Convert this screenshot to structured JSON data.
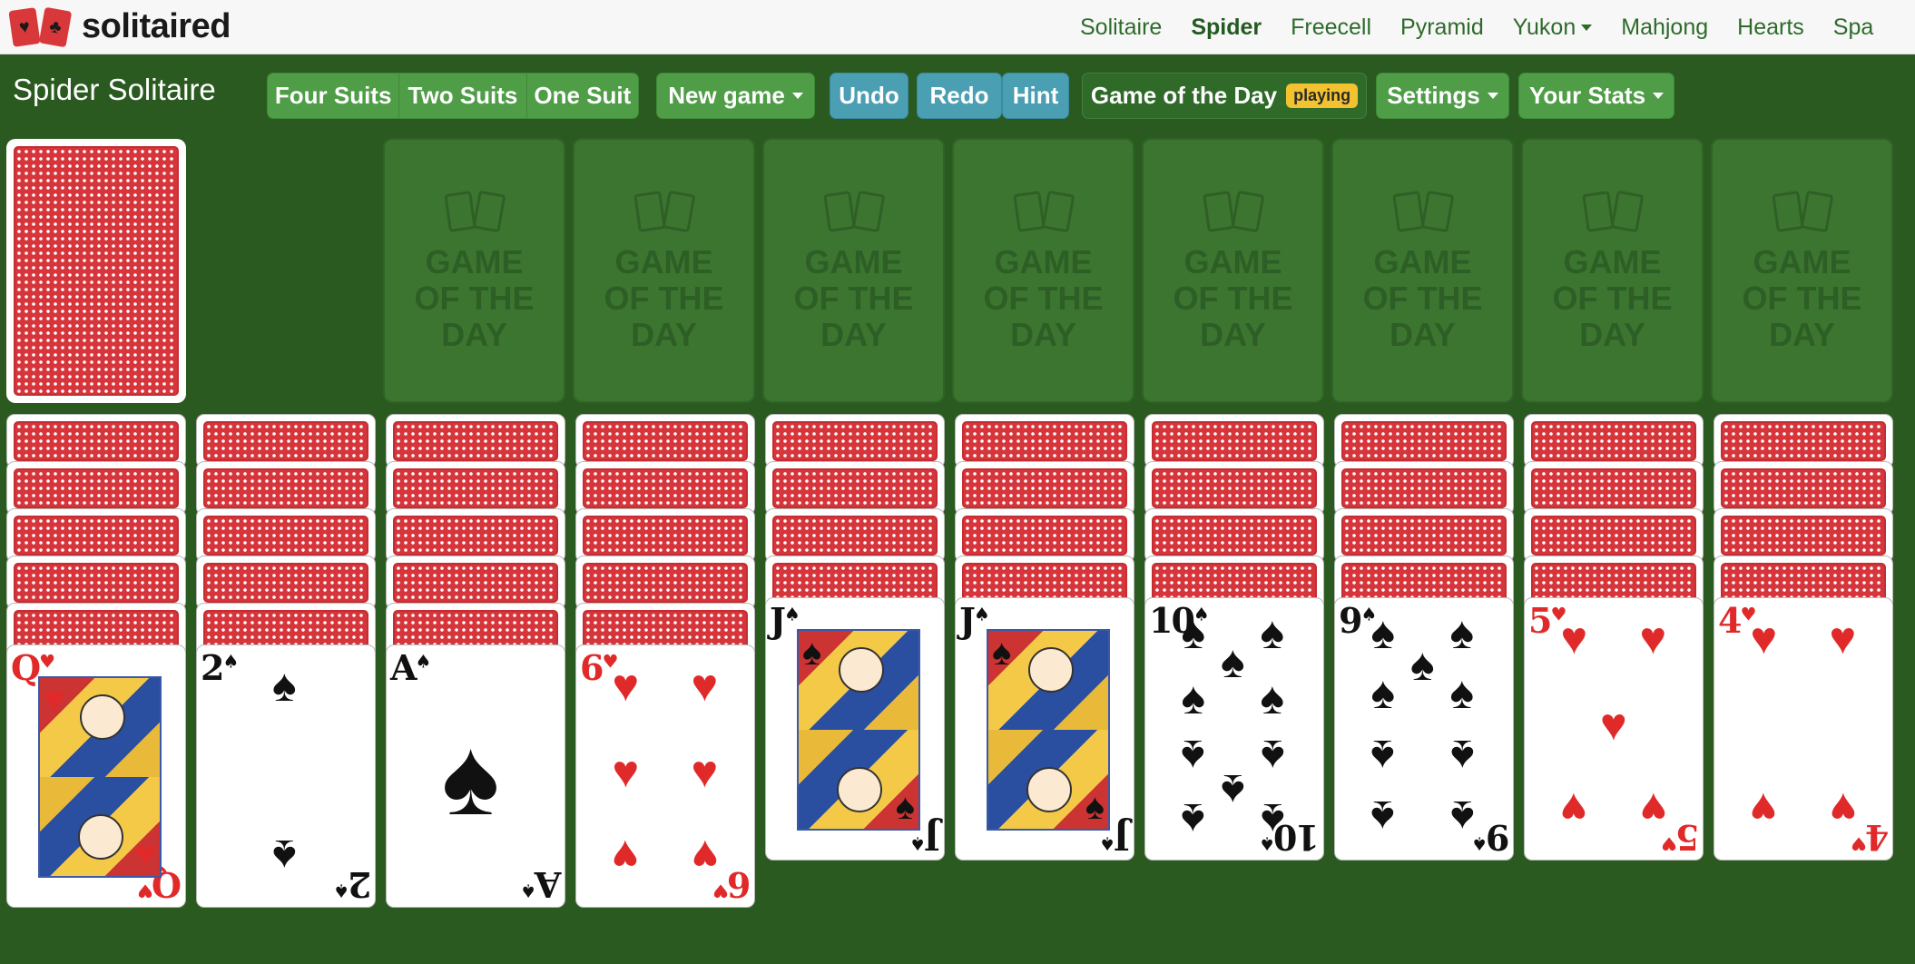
{
  "header": {
    "logo_text": "solitaired",
    "logo_suits": [
      "♥",
      "♣"
    ],
    "nav": [
      {
        "label": "Solitaire",
        "active": false,
        "dropdown": false
      },
      {
        "label": "Spider",
        "active": true,
        "dropdown": false
      },
      {
        "label": "Freecell",
        "active": false,
        "dropdown": false
      },
      {
        "label": "Pyramid",
        "active": false,
        "dropdown": false
      },
      {
        "label": "Yukon",
        "active": false,
        "dropdown": true
      },
      {
        "label": "Mahjong",
        "active": false,
        "dropdown": false
      },
      {
        "label": "Hearts",
        "active": false,
        "dropdown": false
      },
      {
        "label": "Spa",
        "active": false,
        "dropdown": false
      }
    ]
  },
  "toolbar": {
    "title": "Spider Solitaire",
    "suit_options": [
      "Four Suits",
      "Two Suits",
      "One Suit"
    ],
    "new_game": "New game",
    "undo": "Undo",
    "redo": "Redo",
    "hint": "Hint",
    "game_of_day": "Game of the Day",
    "badge": "playing",
    "settings": "Settings",
    "stats": "Your Stats"
  },
  "foundation_placeholder": "GAME OF THE DAY",
  "tableau": [
    {
      "facedown": 5,
      "card": {
        "rank": "Q",
        "suit": "♥",
        "color": "red"
      }
    },
    {
      "facedown": 5,
      "card": {
        "rank": "2",
        "suit": "♠",
        "color": "black"
      }
    },
    {
      "facedown": 5,
      "card": {
        "rank": "A",
        "suit": "♠",
        "color": "black"
      }
    },
    {
      "facedown": 5,
      "card": {
        "rank": "6",
        "suit": "♥",
        "color": "red"
      }
    },
    {
      "facedown": 4,
      "card": {
        "rank": "J",
        "suit": "♠",
        "color": "black"
      }
    },
    {
      "facedown": 4,
      "card": {
        "rank": "J",
        "suit": "♠",
        "color": "black"
      }
    },
    {
      "facedown": 4,
      "card": {
        "rank": "10",
        "suit": "♠",
        "color": "black"
      }
    },
    {
      "facedown": 4,
      "card": {
        "rank": "9",
        "suit": "♠",
        "color": "black"
      }
    },
    {
      "facedown": 4,
      "card": {
        "rank": "5",
        "suit": "♥",
        "color": "red"
      }
    },
    {
      "facedown": 4,
      "card": {
        "rank": "4",
        "suit": "♥",
        "color": "red"
      }
    }
  ],
  "colors": {
    "felt": "#2a5a1f",
    "button_green": "#4f9d47",
    "button_blue": "#4a9fb2",
    "card_back": "#d6363b",
    "badge": "#f2c230"
  }
}
